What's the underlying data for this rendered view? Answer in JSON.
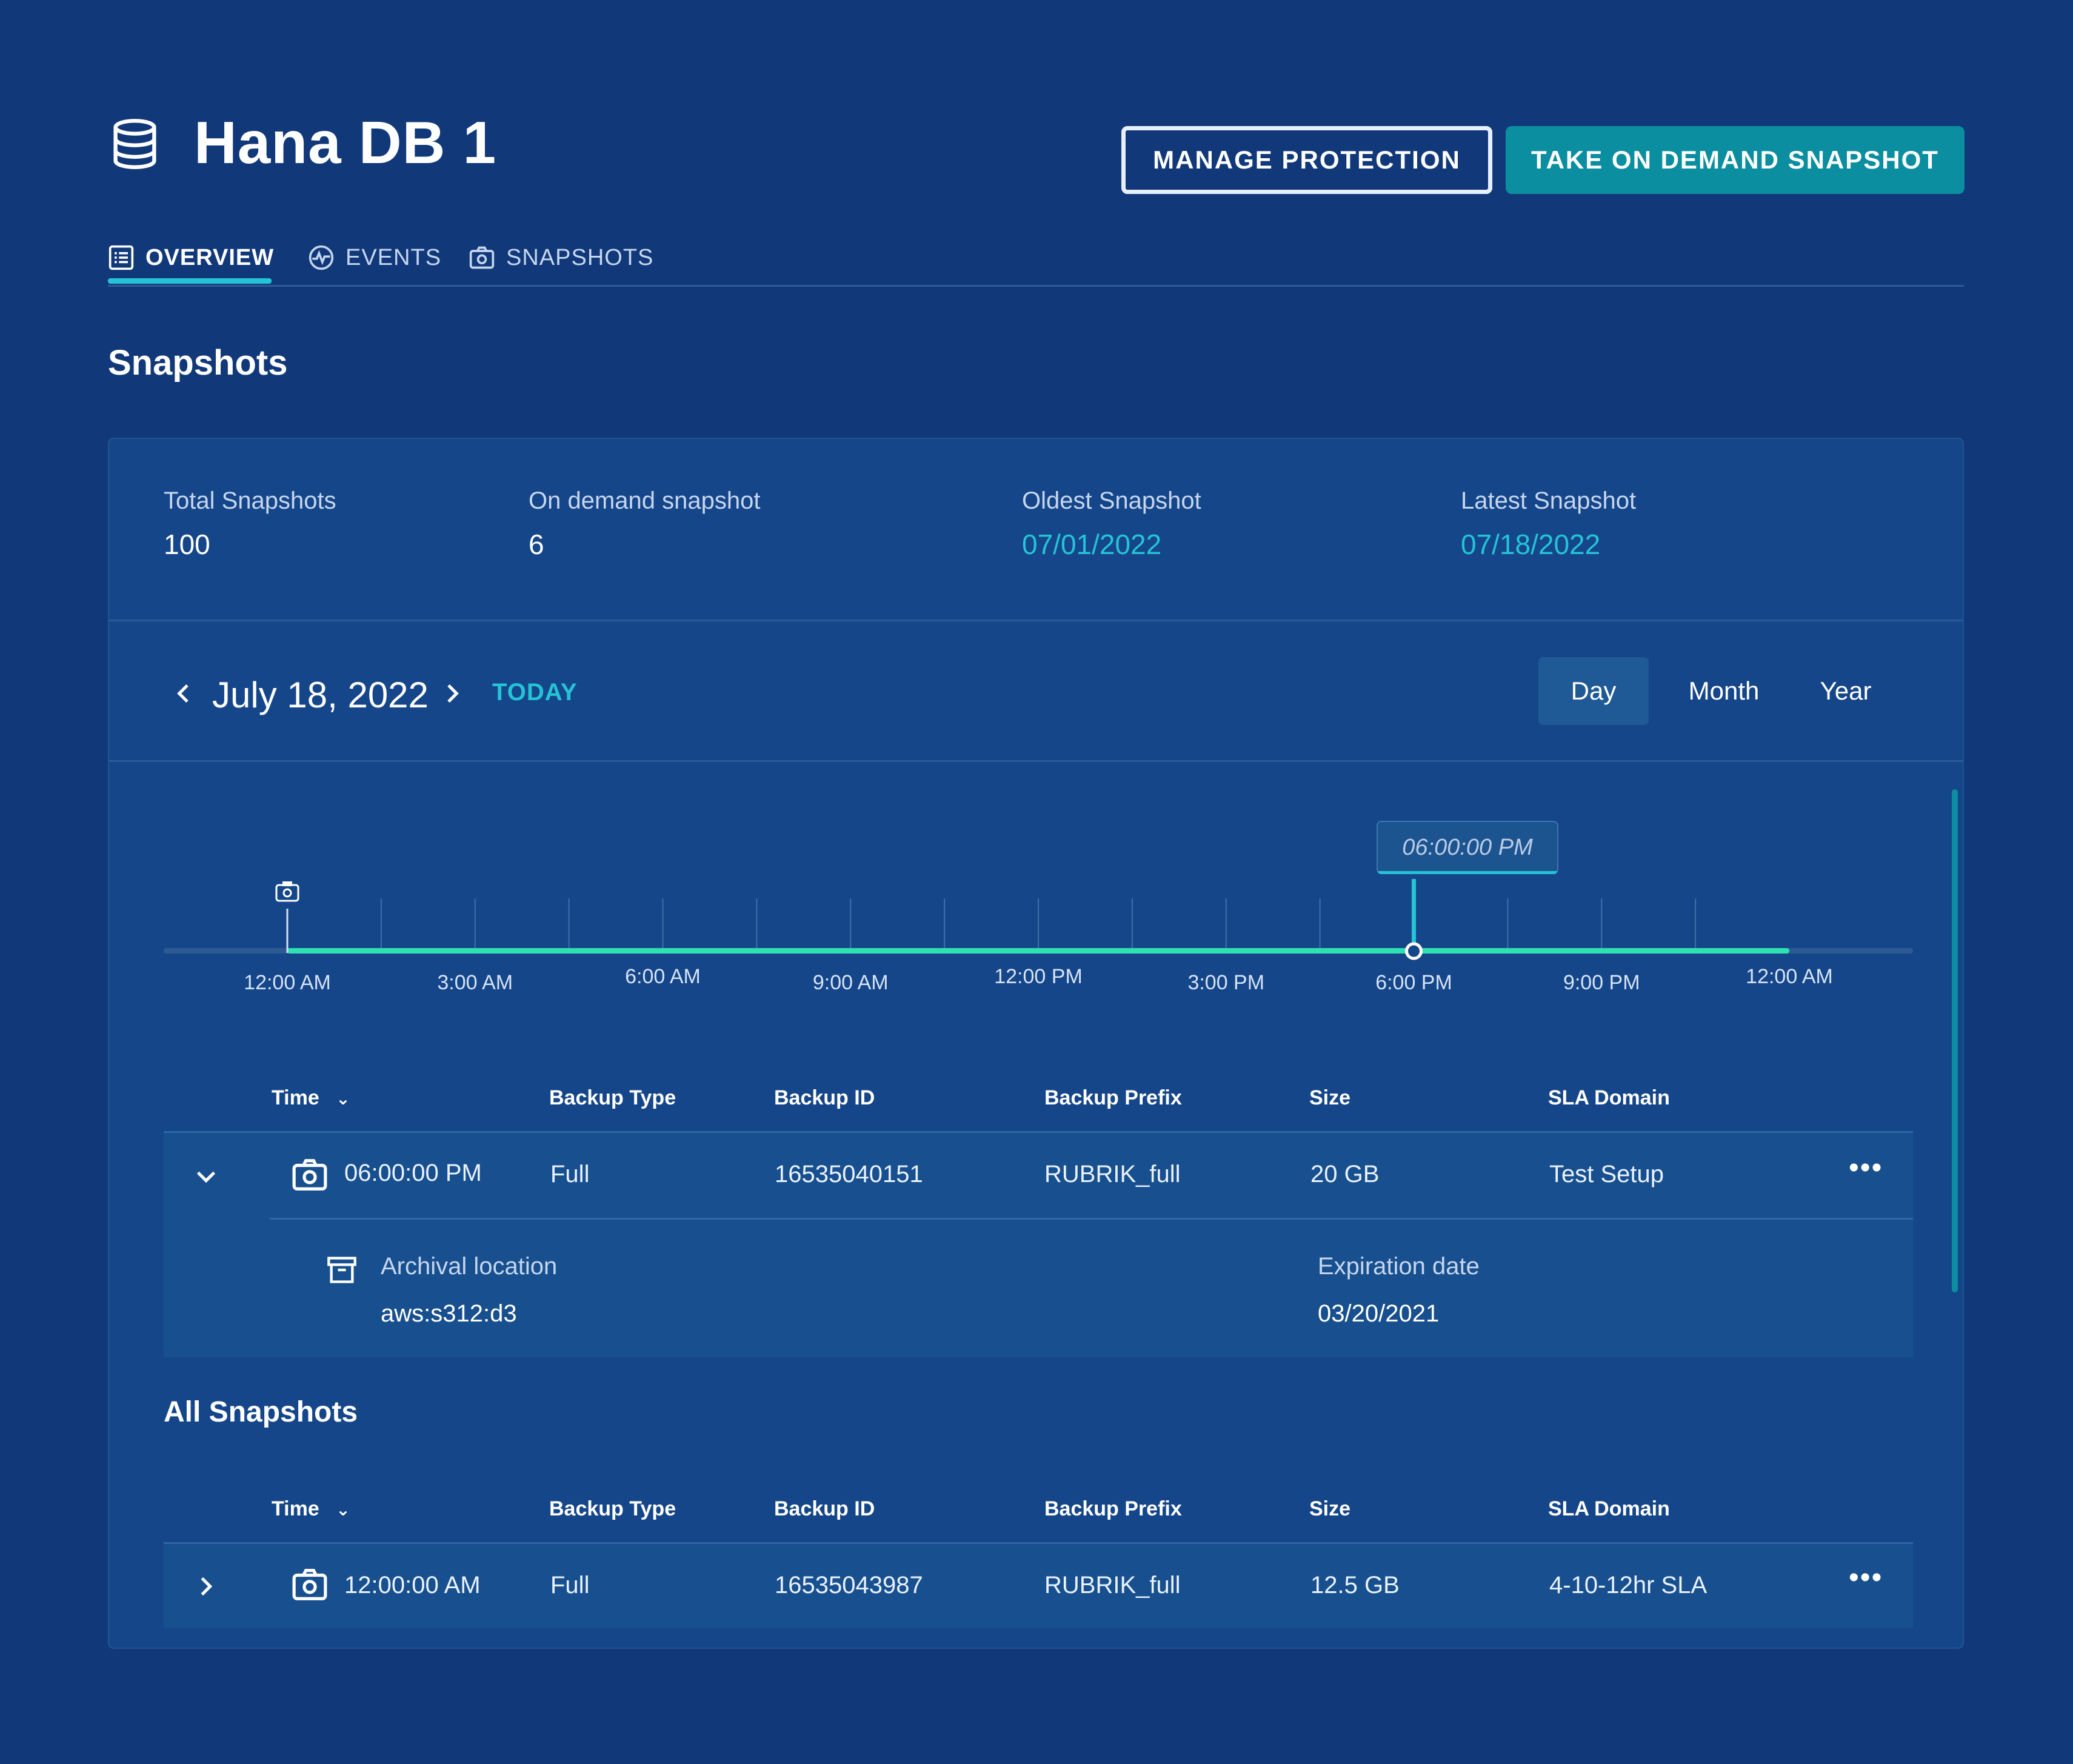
{
  "header": {
    "title": "Hana DB 1",
    "manage_label": "MANAGE PROTECTION",
    "snapshot_label": "TAKE ON DEMAND SNAPSHOT"
  },
  "tabs": [
    {
      "label": "OVERVIEW",
      "icon": "list-icon",
      "active": true
    },
    {
      "label": "EVENTS",
      "icon": "activity-icon",
      "active": false
    },
    {
      "label": "SNAPSHOTS",
      "icon": "camera-icon",
      "active": false
    }
  ],
  "section_title": "Snapshots",
  "stats": {
    "total": {
      "label": "Total Snapshots",
      "value": "100"
    },
    "on_demand": {
      "label": "On demand snapshot",
      "value": "6"
    },
    "oldest": {
      "label": "Oldest Snapshot",
      "value": "07/01/2022"
    },
    "latest": {
      "label": "Latest Snapshot",
      "value": "07/18/2022"
    }
  },
  "date_nav": {
    "date": "July 18, 2022",
    "today_label": "TODAY",
    "ranges": [
      "Day",
      "Month",
      "Year"
    ],
    "active_range": "Day"
  },
  "timeline": {
    "tooltip": "06:00:00 PM",
    "ticks": [
      "12:00 AM",
      "3:00 AM",
      "6:00 AM",
      "9:00 AM",
      "12:00 PM",
      "3:00 PM",
      "6:00 PM",
      "9:00 PM",
      "12:00 AM"
    ],
    "selected_hour": 18
  },
  "columns": [
    "Time",
    "Backup Type",
    "Backup ID",
    "Backup Prefix",
    "Size",
    "SLA Domain"
  ],
  "selected_snapshot": {
    "time": "06:00:00 PM",
    "type": "Full",
    "id": "16535040151",
    "prefix": "RUBRIK_full",
    "size": "20 GB",
    "sla": "Test Setup",
    "archival_label": "Archival location",
    "archival_value": "aws:s312:d3",
    "expiration_label": "Expiration date",
    "expiration_value": "03/20/2021"
  },
  "all_snapshots_title": "All Snapshots",
  "all_snapshots": [
    {
      "time": "12:00:00 AM",
      "type": "Full",
      "id": "16535043987",
      "prefix": "RUBRIK_full",
      "size": "12.5 GB",
      "sla": "4-10-12hr SLA"
    }
  ],
  "colors": {
    "background": "#11397a",
    "panel": "#15468a",
    "accent": "#24c3d6",
    "timeline": "#2ee0b2"
  }
}
